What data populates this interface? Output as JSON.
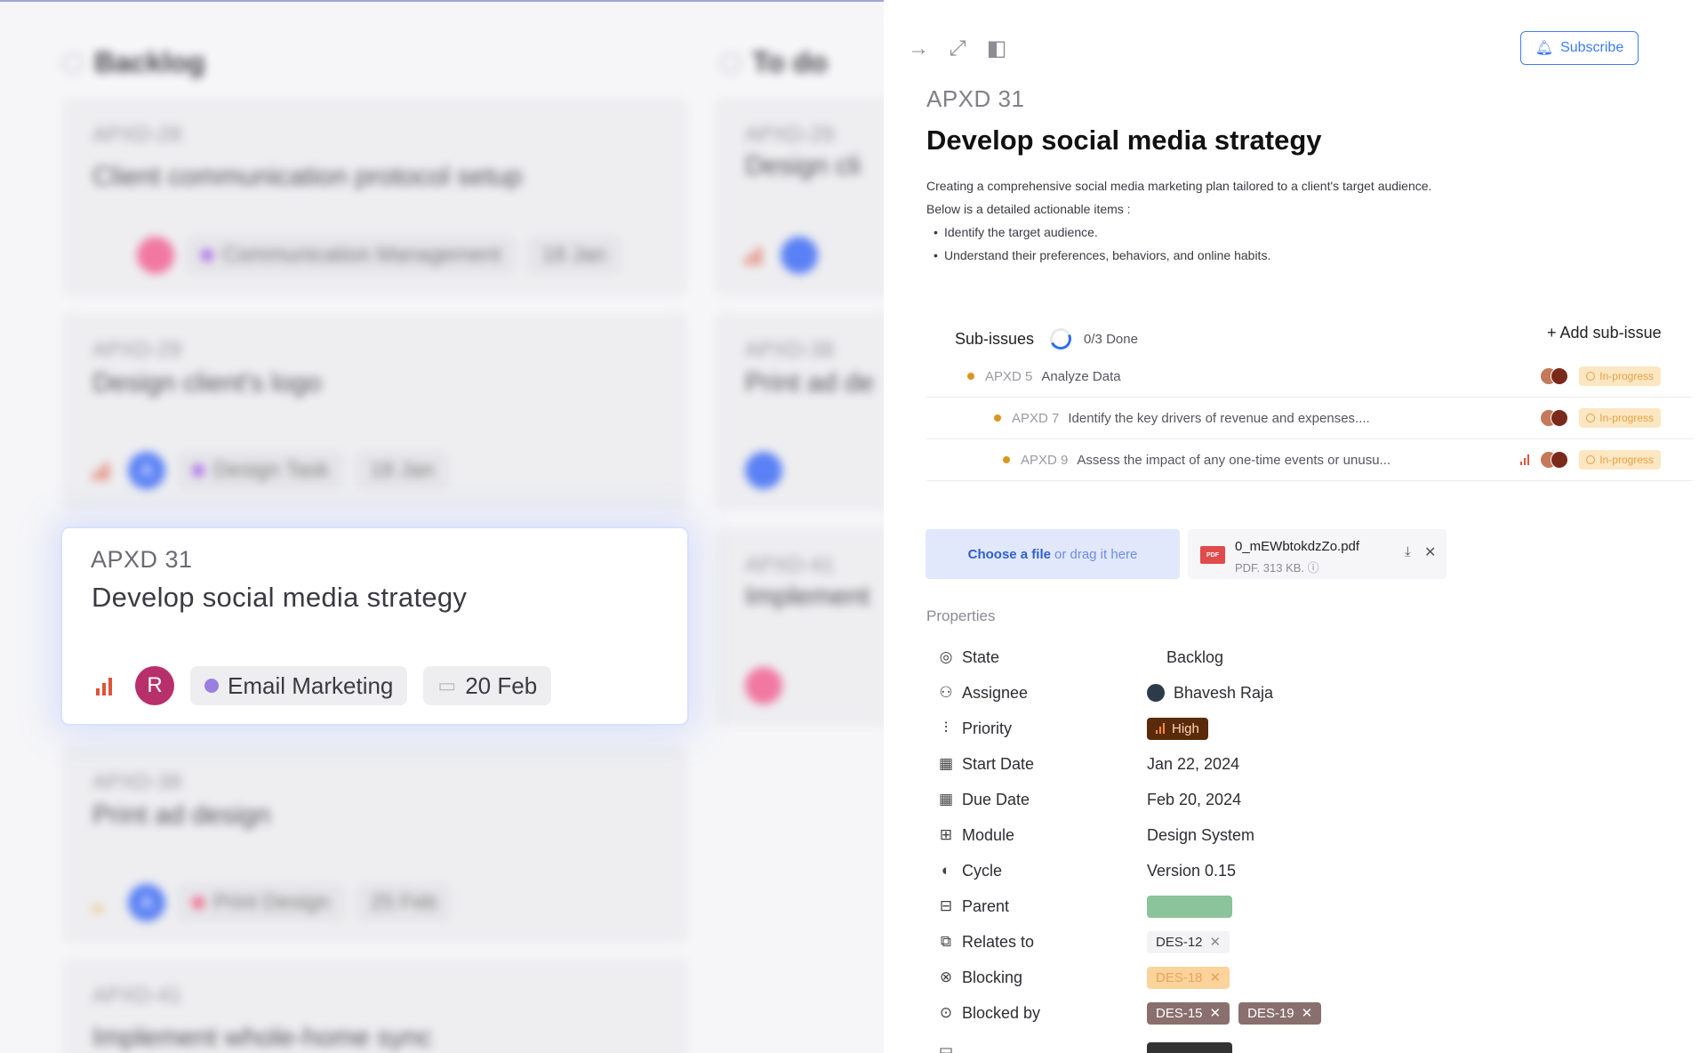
{
  "board": {
    "columns": [
      {
        "title": "Backlog"
      },
      {
        "title": "To do"
      }
    ],
    "backlog_cards": [
      {
        "id": "APXD-28",
        "title": "Client communication protocol setup",
        "tag": "Communication Management",
        "date": "18 Jan",
        "avatar": ""
      },
      {
        "id": "APXD-29",
        "title": "Design client's logo",
        "tag": "Design Task",
        "date": "18 Jan",
        "avatar": "A"
      },
      {
        "id": "APXD-38",
        "title": "Print ad design",
        "tag": "Print Design",
        "date": "25 Feb",
        "avatar": "A"
      },
      {
        "id": "APXD-41",
        "title": "Implement whole-home sync"
      }
    ],
    "todo_cards": [
      {
        "id": "APXD-29",
        "title": "Design cli"
      },
      {
        "id": "APXD-38",
        "title": "Print ad de"
      },
      {
        "id": "APXD-41",
        "title": "Implement"
      }
    ],
    "focused_card": {
      "id": "APXD 31",
      "title": "Develop social media strategy",
      "avatar": "R",
      "label": "Email Marketing",
      "date": "20 Feb"
    }
  },
  "panel": {
    "subscribe_label": "Subscribe",
    "issue_id": "APXD 31",
    "title": "Develop social media strategy",
    "description": {
      "lines": [
        "Creating a comprehensive social media marketing plan tailored to a client's target audience.",
        "Below is a detailed actionable items :"
      ],
      "bullets": [
        "Identify the target audience.",
        "Understand their preferences, behaviors, and online habits."
      ]
    },
    "sub_issues": {
      "label": "Sub-issues",
      "progress": "0/3 Done",
      "add_label": "Add sub-issue",
      "items": [
        {
          "id": "APXD 5",
          "title": "Analyze Data",
          "status": "In-progress"
        },
        {
          "id": "APXD 7",
          "title": "Identify the key drivers of revenue and expenses....",
          "status": "In-progress"
        },
        {
          "id": "APXD 9",
          "title": "Assess the impact of any one-time events or unusu...",
          "status": "In-progress"
        }
      ]
    },
    "upload": {
      "choose": "Choose a file",
      "drag": "or drag it here"
    },
    "attachment": {
      "name": "0_mEWbtokdzZo.pdf",
      "meta": "PDF. 313 KB.",
      "icon_text": "PDF"
    },
    "properties_label": "Properties",
    "properties": {
      "state": {
        "label": "State",
        "value": "Backlog"
      },
      "assignee": {
        "label": "Assignee",
        "value": "Bhavesh Raja"
      },
      "priority": {
        "label": "Priority",
        "value": "High"
      },
      "start_date": {
        "label": "Start Date",
        "value": "Jan 22, 2024"
      },
      "due_date": {
        "label": "Due Date",
        "value": "Feb 20, 2024"
      },
      "module": {
        "label": "Module",
        "value": "Design System"
      },
      "cycle": {
        "label": "Cycle",
        "value": "Version 0.15"
      },
      "parent": {
        "label": "Parent",
        "value": ""
      },
      "relates_to": {
        "label": "Relates to",
        "value": "DES-12"
      },
      "blocking": {
        "label": "Blocking",
        "value": "DES-18"
      },
      "blocked_by": {
        "label": "Blocked by",
        "values": [
          "DES-15",
          "DES-19"
        ]
      }
    }
  },
  "colors": {
    "accent": "#3e7bfa",
    "priority_high": "#5a2a0a",
    "in_progress": "#e5a043"
  }
}
